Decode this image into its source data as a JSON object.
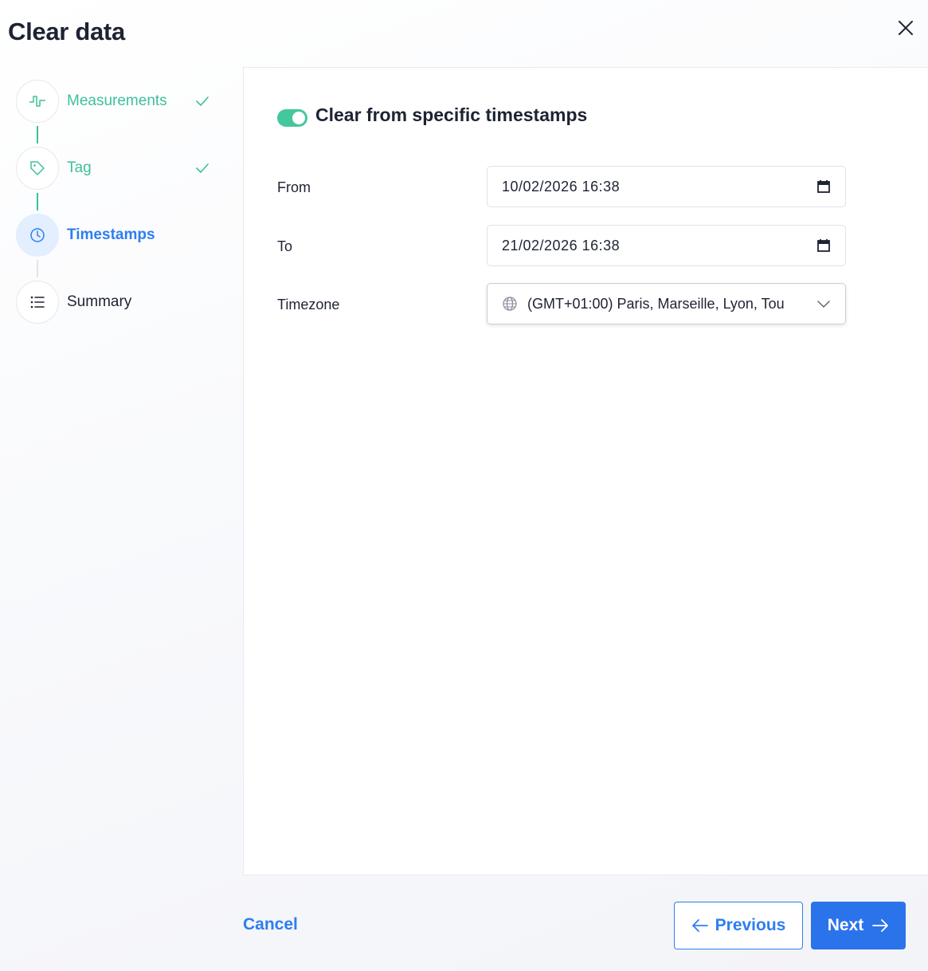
{
  "dialog": {
    "title": "Clear data"
  },
  "stepper": {
    "steps": [
      {
        "label": "Measurements",
        "state": "done",
        "icon": "pulse-icon"
      },
      {
        "label": "Tag",
        "state": "done",
        "icon": "tag-icon"
      },
      {
        "label": "Timestamps",
        "state": "active",
        "icon": "clock-icon"
      },
      {
        "label": "Summary",
        "state": "todo",
        "icon": "list-icon"
      }
    ]
  },
  "form": {
    "toggle_label": "Clear from specific timestamps",
    "toggle_on": true,
    "from_label": "From",
    "from_value": "10/02/2026 16:38",
    "to_label": "To",
    "to_value": "21/02/2026 16:38",
    "timezone_label": "Timezone",
    "timezone_value": "(GMT+01:00) Paris, Marseille, Lyon, Tou"
  },
  "footer": {
    "cancel_label": "Cancel",
    "previous_label": "Previous",
    "next_label": "Next"
  },
  "colors": {
    "accent": "#2d7ef0",
    "done": "#3fbf9b",
    "toggle_on": "#45c79e"
  }
}
